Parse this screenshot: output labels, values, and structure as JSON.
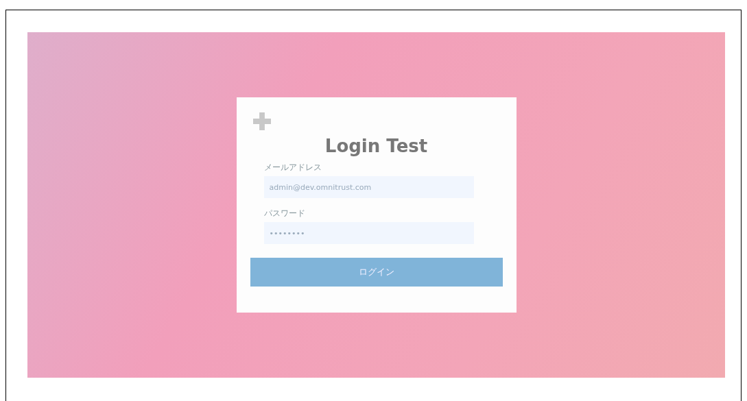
{
  "heading": "Login Test",
  "email": {
    "label": "メールアドレス",
    "value": "admin@dev.omnitrust.com"
  },
  "password": {
    "label": "パスワード",
    "value": "••••••••"
  },
  "submit": {
    "label": "ログイン"
  }
}
